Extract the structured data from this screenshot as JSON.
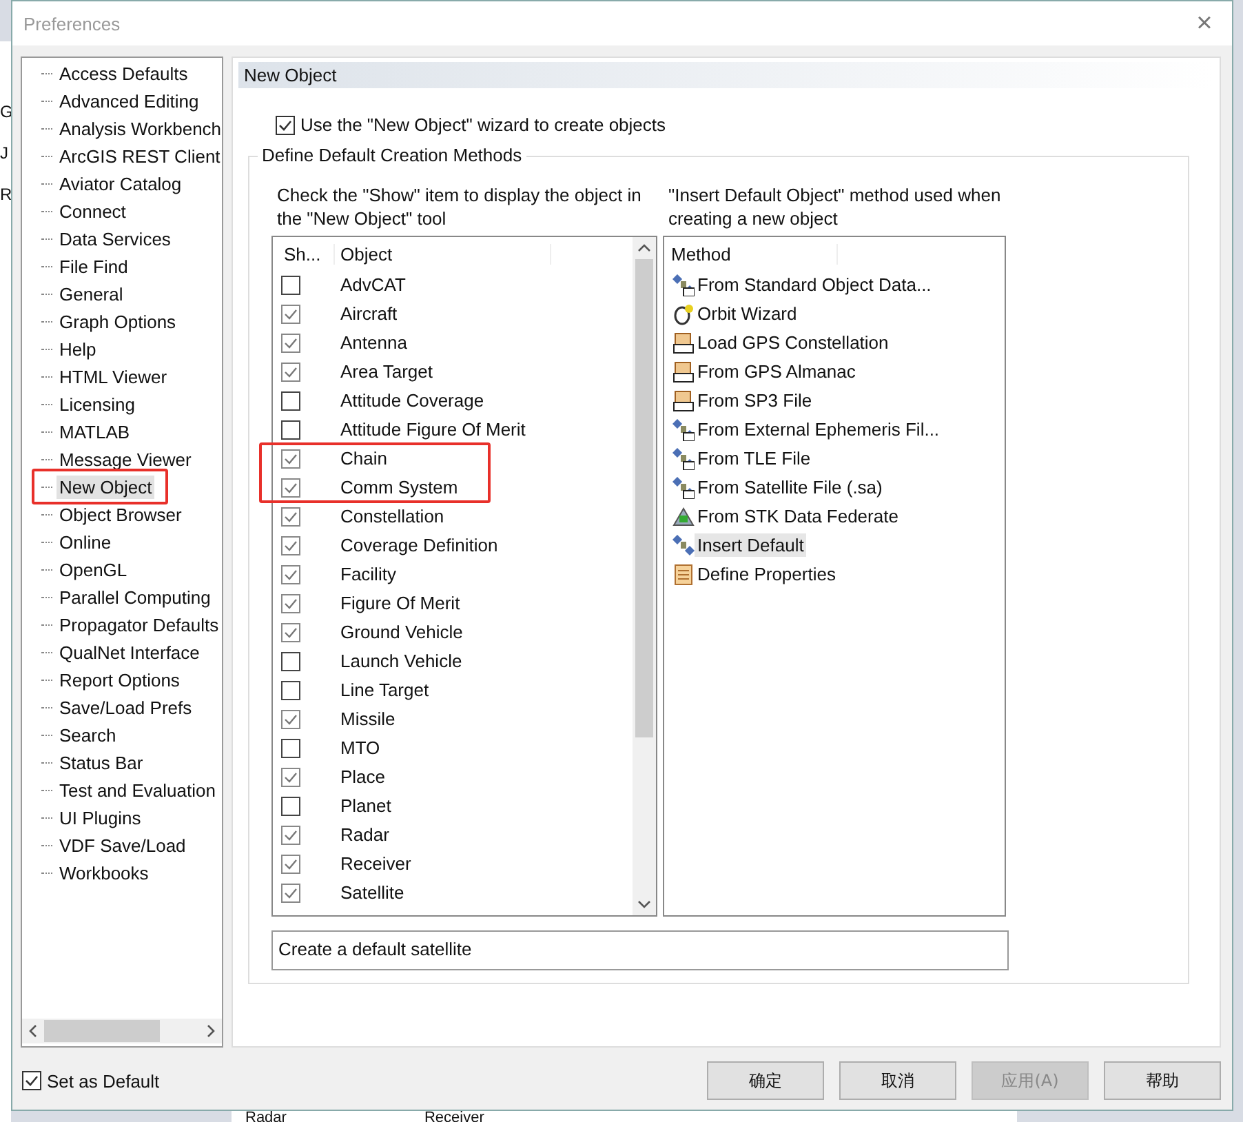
{
  "background": {
    "fragments_left": [
      "G",
      "J",
      "R"
    ],
    "fragments_bottom": [
      "Radar",
      "Receiver"
    ]
  },
  "window": {
    "title": "Preferences",
    "close": "×"
  },
  "tree": {
    "items": [
      {
        "label": "Access Defaults",
        "selected": false
      },
      {
        "label": "Advanced Editing",
        "selected": false
      },
      {
        "label": "Analysis Workbench",
        "selected": false
      },
      {
        "label": "ArcGIS REST Client",
        "selected": false
      },
      {
        "label": "Aviator Catalog",
        "selected": false
      },
      {
        "label": "Connect",
        "selected": false
      },
      {
        "label": "Data Services",
        "selected": false
      },
      {
        "label": "File Find",
        "selected": false
      },
      {
        "label": "General",
        "selected": false
      },
      {
        "label": "Graph Options",
        "selected": false
      },
      {
        "label": "Help",
        "selected": false
      },
      {
        "label": "HTML Viewer",
        "selected": false
      },
      {
        "label": "Licensing",
        "selected": false
      },
      {
        "label": "MATLAB",
        "selected": false
      },
      {
        "label": "Message Viewer",
        "selected": false
      },
      {
        "label": "New Object",
        "selected": true
      },
      {
        "label": "Object Browser",
        "selected": false
      },
      {
        "label": "Online",
        "selected": false
      },
      {
        "label": "OpenGL",
        "selected": false
      },
      {
        "label": "Parallel Computing",
        "selected": false
      },
      {
        "label": "Propagator Defaults",
        "selected": false
      },
      {
        "label": "QualNet Interface",
        "selected": false
      },
      {
        "label": "Report Options",
        "selected": false
      },
      {
        "label": "Save/Load Prefs",
        "selected": false
      },
      {
        "label": "Search",
        "selected": false
      },
      {
        "label": "Status Bar",
        "selected": false
      },
      {
        "label": "Test and Evaluation",
        "selected": false
      },
      {
        "label": "UI Plugins",
        "selected": false
      },
      {
        "label": "VDF Save/Load",
        "selected": false
      },
      {
        "label": "Workbooks",
        "selected": false
      }
    ]
  },
  "panel": {
    "header": "New Object",
    "wizard": {
      "label": "Use the \"New Object\" wizard to create objects",
      "checked": true
    },
    "group": {
      "title": "Define Default Creation Methods",
      "left_hint": "Check the \"Show\" item to display the object in the \"New Object\" tool",
      "right_hint": "\"Insert Default Object\" method used when creating a new object",
      "objects": {
        "columns": [
          "Sh...",
          "Object"
        ],
        "rows": [
          {
            "name": "AdvCAT",
            "checked": false
          },
          {
            "name": "Aircraft",
            "checked": true
          },
          {
            "name": "Antenna",
            "checked": true
          },
          {
            "name": "Area Target",
            "checked": true
          },
          {
            "name": "Attitude Coverage",
            "checked": false
          },
          {
            "name": "Attitude Figure Of Merit",
            "checked": false
          },
          {
            "name": "Chain",
            "checked": true
          },
          {
            "name": "Comm System",
            "checked": true
          },
          {
            "name": "Constellation",
            "checked": true
          },
          {
            "name": "Coverage Definition",
            "checked": true
          },
          {
            "name": "Facility",
            "checked": true
          },
          {
            "name": "Figure Of Merit",
            "checked": true
          },
          {
            "name": "Ground Vehicle",
            "checked": true
          },
          {
            "name": "Launch Vehicle",
            "checked": false
          },
          {
            "name": "Line Target",
            "checked": false
          },
          {
            "name": "Missile",
            "checked": true
          },
          {
            "name": "MTO",
            "checked": false
          },
          {
            "name": "Place",
            "checked": true
          },
          {
            "name": "Planet",
            "checked": false
          },
          {
            "name": "Radar",
            "checked": true
          },
          {
            "name": "Receiver",
            "checked": true
          },
          {
            "name": "Satellite",
            "checked": true
          }
        ]
      },
      "methods": {
        "column": "Method",
        "rows": [
          {
            "label": "From Standard Object Data...",
            "kind": "satellite",
            "selected": false
          },
          {
            "label": "Orbit Wizard",
            "kind": "orbit",
            "selected": false
          },
          {
            "label": "Load GPS Constellation",
            "kind": "gps",
            "selected": false
          },
          {
            "label": "From GPS Almanac",
            "kind": "gps",
            "selected": false
          },
          {
            "label": "From SP3 File",
            "kind": "gps",
            "selected": false
          },
          {
            "label": "From External Ephemeris Fil...",
            "kind": "satellite",
            "selected": false
          },
          {
            "label": "From TLE File",
            "kind": "satellite",
            "selected": false
          },
          {
            "label": "From Satellite File (.sa)",
            "kind": "satellite",
            "selected": false
          },
          {
            "label": "From STK Data Federate",
            "kind": "federate",
            "selected": false
          },
          {
            "label": "Insert Default",
            "kind": "satellite-plain",
            "selected": true
          },
          {
            "label": "Define Properties",
            "kind": "properties",
            "selected": false
          }
        ]
      },
      "description": "Create a default satellite"
    }
  },
  "set_default": {
    "label": "Set as Default",
    "checked": true
  },
  "buttons": [
    {
      "label": "确定",
      "disabled": false
    },
    {
      "label": "取消",
      "disabled": false
    },
    {
      "label": "应用(A)",
      "disabled": true
    },
    {
      "label": "帮助",
      "disabled": false
    }
  ]
}
